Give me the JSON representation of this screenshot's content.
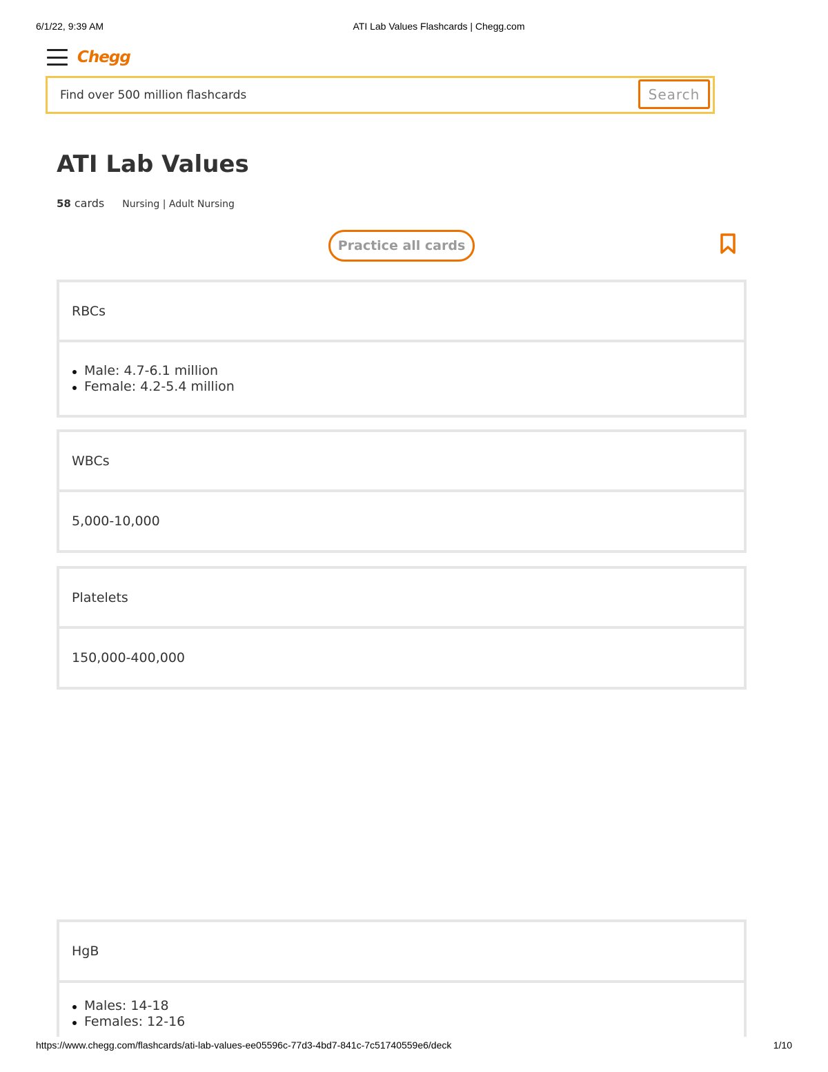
{
  "print_header": {
    "datetime": "6/1/22, 9:39 AM",
    "title": "ATI Lab Values Flashcards | Chegg.com"
  },
  "print_footer": {
    "url": "https://www.chegg.com/flashcards/ati-lab-values-ee05596c-77d3-4bd7-841c-7c51740559e6/deck",
    "page": "1/10"
  },
  "nav": {
    "menu_icon": "hamburger-menu-icon",
    "logo": "Chegg"
  },
  "search": {
    "placeholder": "Find over 500 million flashcards",
    "button_label": "Search"
  },
  "deck": {
    "title": "ATI Lab Values",
    "card_count": "58",
    "cards_label": "cards",
    "subjects": "Nursing | Adult Nursing",
    "practice_label": "Practice all cards",
    "bookmark_icon": "bookmark-icon"
  },
  "cards": [
    {
      "front": "RBCs",
      "back_list": [
        "Male: 4.7-6.1 million",
        "Female: 4.2-5.4 million"
      ]
    },
    {
      "front": "WBCs",
      "back": "5,000-10,000"
    },
    {
      "front": "Platelets",
      "back": "150,000-400,000"
    },
    {
      "front": "HgB",
      "back_list": [
        "Males: 14-18",
        "Females: 12-16"
      ]
    }
  ],
  "colors": {
    "brand_orange": "#eb7100",
    "search_border": "#f3c64f",
    "card_border": "#e6e6e6"
  }
}
